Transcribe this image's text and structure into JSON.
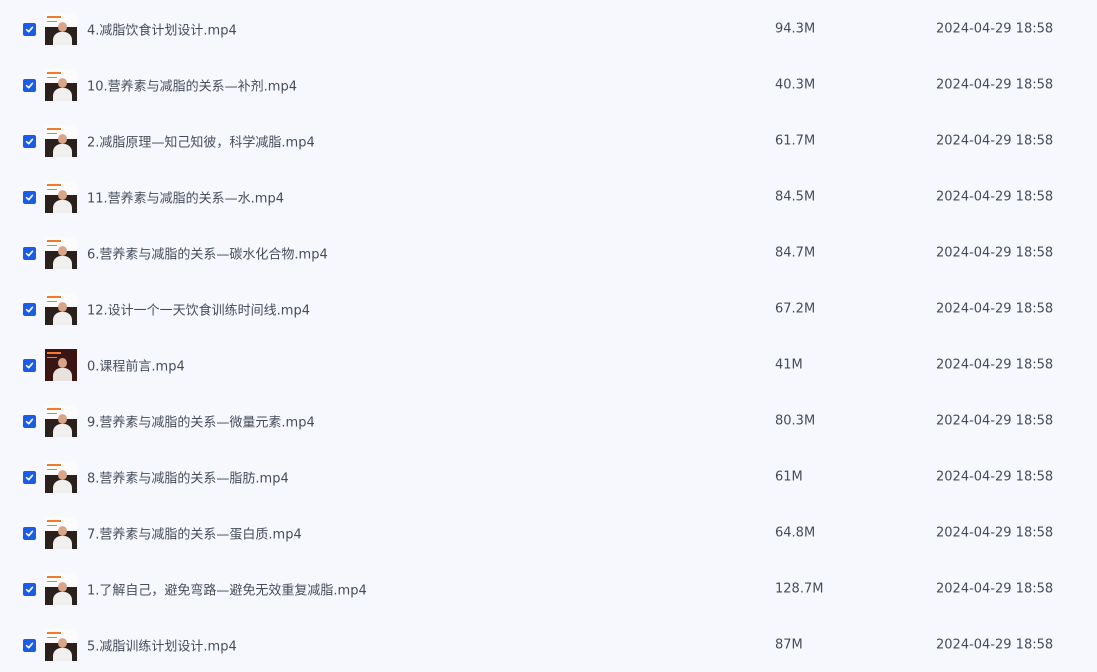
{
  "files": [
    {
      "name": "4.减脂饮食计划设计.mp4",
      "size": "94.3M",
      "date": "2024-04-29 18:58",
      "checked": true
    },
    {
      "name": "10.营养素与减脂的关系—补剂.mp4",
      "size": "40.3M",
      "date": "2024-04-29 18:58",
      "checked": true
    },
    {
      "name": "2.减脂原理—知己知彼，科学减脂.mp4",
      "size": "61.7M",
      "date": "2024-04-29 18:58",
      "checked": true
    },
    {
      "name": "11.营养素与减脂的关系—水.mp4",
      "size": "84.5M",
      "date": "2024-04-29 18:58",
      "checked": true
    },
    {
      "name": "6.营养素与减脂的关系—碳水化合物.mp4",
      "size": "84.7M",
      "date": "2024-04-29 18:58",
      "checked": true
    },
    {
      "name": "12.设计一个一天饮食训练时间线.mp4",
      "size": "67.2M",
      "date": "2024-04-29 18:58",
      "checked": true
    },
    {
      "name": "0.课程前言.mp4",
      "size": "41M",
      "date": "2024-04-29 18:58",
      "checked": true
    },
    {
      "name": "9.营养素与减脂的关系—微量元素.mp4",
      "size": "80.3M",
      "date": "2024-04-29 18:58",
      "checked": true
    },
    {
      "name": "8.营养素与减脂的关系—脂肪.mp4",
      "size": "61M",
      "date": "2024-04-29 18:58",
      "checked": true
    },
    {
      "name": "7.营养素与减脂的关系—蛋白质.mp4",
      "size": "64.8M",
      "date": "2024-04-29 18:58",
      "checked": true
    },
    {
      "name": "1.了解自己，避免弯路—避免无效重复减脂.mp4",
      "size": "128.7M",
      "date": "2024-04-29 18:58",
      "checked": true
    },
    {
      "name": "5.减脂训练计划设计.mp4",
      "size": "87M",
      "date": "2024-04-29 18:58",
      "checked": true
    }
  ],
  "icons": {
    "checkbox": "checkbox-checked-icon",
    "thumbnail": "video-thumbnail"
  },
  "colors": {
    "background": "#f7f8fe",
    "checkbox": "#1b5ce6",
    "text": "#454d5a"
  }
}
